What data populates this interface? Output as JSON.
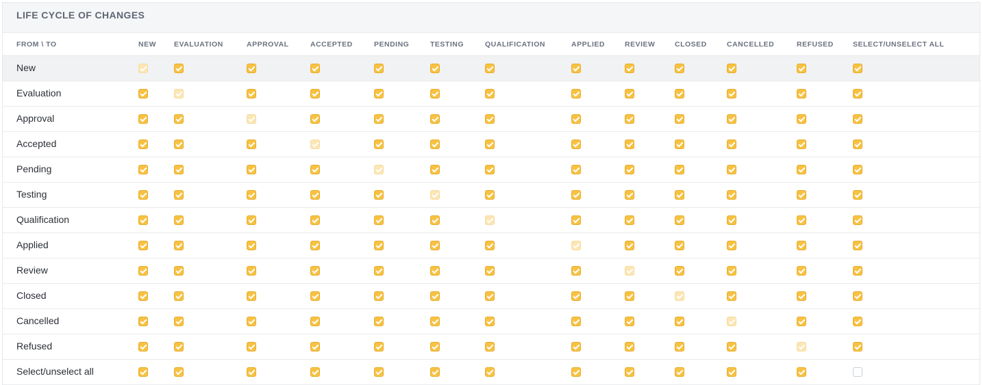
{
  "panel": {
    "title": "LIFE CYCLE OF CHANGES"
  },
  "columns": [
    "FROM \\ TO",
    "NEW",
    "EVALUATION",
    "APPROVAL",
    "ACCEPTED",
    "PENDING",
    "TESTING",
    "QUALIFICATION",
    "APPLIED",
    "REVIEW",
    "CLOSED",
    "CANCELLED",
    "REFUSED",
    "SELECT/UNSELECT ALL"
  ],
  "rows": [
    {
      "label": "New",
      "cells": [
        "disabled",
        "checked",
        "checked",
        "checked",
        "checked",
        "checked",
        "checked",
        "checked",
        "checked",
        "checked",
        "checked",
        "checked",
        "checked"
      ]
    },
    {
      "label": "Evaluation",
      "cells": [
        "checked",
        "disabled",
        "checked",
        "checked",
        "checked",
        "checked",
        "checked",
        "checked",
        "checked",
        "checked",
        "checked",
        "checked",
        "checked"
      ]
    },
    {
      "label": "Approval",
      "cells": [
        "checked",
        "checked",
        "disabled",
        "checked",
        "checked",
        "checked",
        "checked",
        "checked",
        "checked",
        "checked",
        "checked",
        "checked",
        "checked"
      ]
    },
    {
      "label": "Accepted",
      "cells": [
        "checked",
        "checked",
        "checked",
        "disabled",
        "checked",
        "checked",
        "checked",
        "checked",
        "checked",
        "checked",
        "checked",
        "checked",
        "checked"
      ]
    },
    {
      "label": "Pending",
      "cells": [
        "checked",
        "checked",
        "checked",
        "checked",
        "disabled",
        "checked",
        "checked",
        "checked",
        "checked",
        "checked",
        "checked",
        "checked",
        "checked"
      ]
    },
    {
      "label": "Testing",
      "cells": [
        "checked",
        "checked",
        "checked",
        "checked",
        "checked",
        "disabled",
        "checked",
        "checked",
        "checked",
        "checked",
        "checked",
        "checked",
        "checked"
      ]
    },
    {
      "label": "Qualification",
      "cells": [
        "checked",
        "checked",
        "checked",
        "checked",
        "checked",
        "checked",
        "disabled",
        "checked",
        "checked",
        "checked",
        "checked",
        "checked",
        "checked"
      ]
    },
    {
      "label": "Applied",
      "cells": [
        "checked",
        "checked",
        "checked",
        "checked",
        "checked",
        "checked",
        "checked",
        "disabled",
        "checked",
        "checked",
        "checked",
        "checked",
        "checked"
      ]
    },
    {
      "label": "Review",
      "cells": [
        "checked",
        "checked",
        "checked",
        "checked",
        "checked",
        "checked",
        "checked",
        "checked",
        "disabled",
        "checked",
        "checked",
        "checked",
        "checked"
      ]
    },
    {
      "label": "Closed",
      "cells": [
        "checked",
        "checked",
        "checked",
        "checked",
        "checked",
        "checked",
        "checked",
        "checked",
        "checked",
        "disabled",
        "checked",
        "checked",
        "checked"
      ]
    },
    {
      "label": "Cancelled",
      "cells": [
        "checked",
        "checked",
        "checked",
        "checked",
        "checked",
        "checked",
        "checked",
        "checked",
        "checked",
        "checked",
        "disabled",
        "checked",
        "checked"
      ]
    },
    {
      "label": "Refused",
      "cells": [
        "checked",
        "checked",
        "checked",
        "checked",
        "checked",
        "checked",
        "checked",
        "checked",
        "checked",
        "checked",
        "checked",
        "disabled",
        "checked"
      ]
    },
    {
      "label": "Select/unselect all",
      "cells": [
        "checked",
        "checked",
        "checked",
        "checked",
        "checked",
        "checked",
        "checked",
        "checked",
        "checked",
        "checked",
        "checked",
        "checked",
        "unchecked"
      ]
    }
  ],
  "highlighted_row": "New",
  "colors": {
    "checkbox_checked": "#f7c244",
    "checkbox_disabled": "#fbe6b4",
    "header_bg": "#f5f6f8",
    "row_highlight": "#f1f2f4"
  }
}
